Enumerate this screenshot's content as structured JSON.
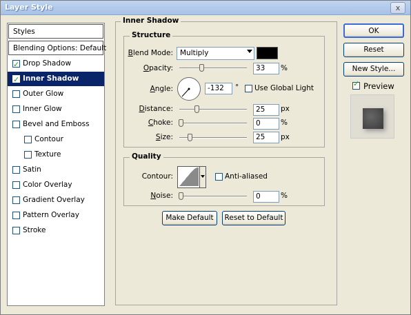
{
  "window": {
    "title": "Layer Style",
    "close_glyph": "x"
  },
  "left_panel": {
    "styles_label": "Styles",
    "blending_label": "Blending Options: Default",
    "items": [
      {
        "label": "Drop Shadow",
        "checked": true,
        "selected": false,
        "indent": false
      },
      {
        "label": "Inner Shadow",
        "checked": true,
        "selected": true,
        "indent": false
      },
      {
        "label": "Outer Glow",
        "checked": false,
        "selected": false,
        "indent": false
      },
      {
        "label": "Inner Glow",
        "checked": false,
        "selected": false,
        "indent": false
      },
      {
        "label": "Bevel and Emboss",
        "checked": false,
        "selected": false,
        "indent": false
      },
      {
        "label": "Contour",
        "checked": false,
        "selected": false,
        "indent": true
      },
      {
        "label": "Texture",
        "checked": false,
        "selected": false,
        "indent": true
      },
      {
        "label": "Satin",
        "checked": false,
        "selected": false,
        "indent": false
      },
      {
        "label": "Color Overlay",
        "checked": false,
        "selected": false,
        "indent": false
      },
      {
        "label": "Gradient Overlay",
        "checked": false,
        "selected": false,
        "indent": false
      },
      {
        "label": "Pattern Overlay",
        "checked": false,
        "selected": false,
        "indent": false
      },
      {
        "label": "Stroke",
        "checked": false,
        "selected": false,
        "indent": false
      }
    ]
  },
  "inner_shadow": {
    "title": "Inner Shadow",
    "structure": {
      "title": "Structure",
      "blend_mode_label": "Blend Mode:",
      "blend_mode_value": "Multiply",
      "shadow_color": "#000000",
      "opacity_label": "Opacity:",
      "opacity_value": "33",
      "opacity_unit": "%",
      "opacity_level": 0.33,
      "angle_label": "Angle:",
      "angle_value": "-132",
      "angle_unit": "°",
      "use_global_light_label": "Use Global Light",
      "use_global_light": false,
      "distance_label": "Distance:",
      "distance_value": "25",
      "distance_unit": "px",
      "distance_level": 0.25,
      "choke_label": "Choke:",
      "choke_value": "0",
      "choke_unit": "%",
      "choke_level": 0,
      "size_label": "Size:",
      "size_value": "25",
      "size_unit": "px",
      "size_level": 0.14
    },
    "quality": {
      "title": "Quality",
      "contour_label": "Contour:",
      "anti_aliased_label": "Anti-aliased",
      "anti_aliased": false,
      "noise_label": "Noise:",
      "noise_value": "0",
      "noise_unit": "%",
      "noise_level": 0
    },
    "make_default_label": "Make Default",
    "reset_default_label": "Reset to Default"
  },
  "right_panel": {
    "ok_label": "OK",
    "reset_label": "Reset",
    "new_style_label": "New Style...",
    "preview_label": "Preview",
    "preview_checked": true
  }
}
